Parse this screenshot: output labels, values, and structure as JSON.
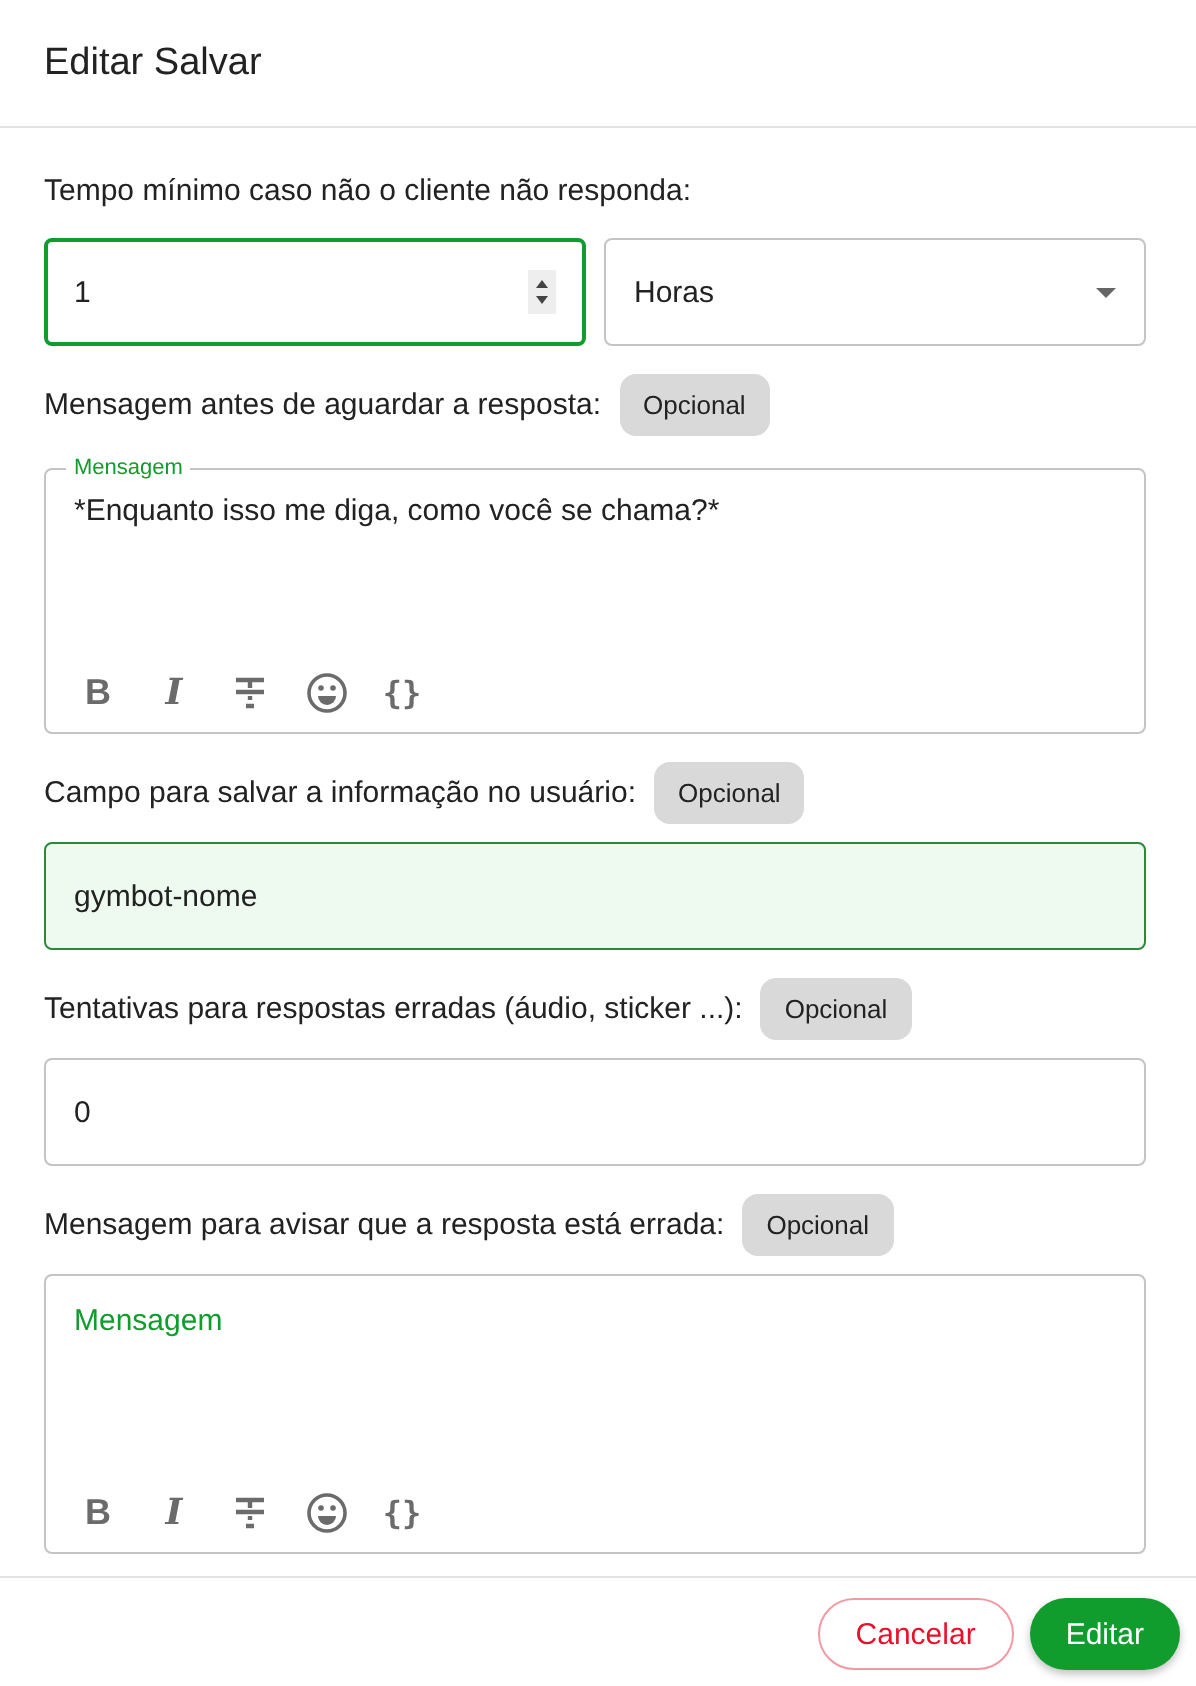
{
  "dialog": {
    "title": "Editar Salvar"
  },
  "fields": [
    {
      "kind": "number_unit",
      "label": "Tempo mínimo caso não o cliente não responda:",
      "value": "1",
      "focused": true,
      "unit": "Horas"
    },
    {
      "kind": "message",
      "label": "Mensagem antes de aguardar a resposta:",
      "badge": "Opcional",
      "floating_label": "Mensagem",
      "value": "*Enquanto isso me diga, como você se chama?*",
      "toolbar": [
        {
          "kind": "bold",
          "label": "B"
        },
        {
          "kind": "italic",
          "label": "I"
        },
        {
          "kind": "strike"
        },
        {
          "kind": "emoji"
        },
        {
          "kind": "braces",
          "label": "{}"
        }
      ]
    },
    {
      "kind": "text",
      "label": "Campo para salvar a informação no usuário:",
      "badge": "Opcional",
      "value": "gymbot-nome",
      "highlighted": true
    },
    {
      "kind": "text",
      "label": "Tentativas para respostas erradas (áudio, sticker ...):",
      "badge": "Opcional",
      "value": "0",
      "highlighted": false
    },
    {
      "kind": "message",
      "label": "Mensagem para avisar que a resposta está errada:",
      "badge": "Opcional",
      "placeholder": "Mensagem",
      "toolbar": [
        {
          "kind": "bold",
          "label": "B"
        },
        {
          "kind": "italic",
          "label": "I"
        },
        {
          "kind": "strike"
        },
        {
          "kind": "emoji"
        },
        {
          "kind": "braces",
          "label": "{}"
        }
      ]
    }
  ],
  "buttons": [
    {
      "kind": "cancel",
      "label": "Cancelar"
    },
    {
      "kind": "primary",
      "label": "Editar"
    }
  ]
}
